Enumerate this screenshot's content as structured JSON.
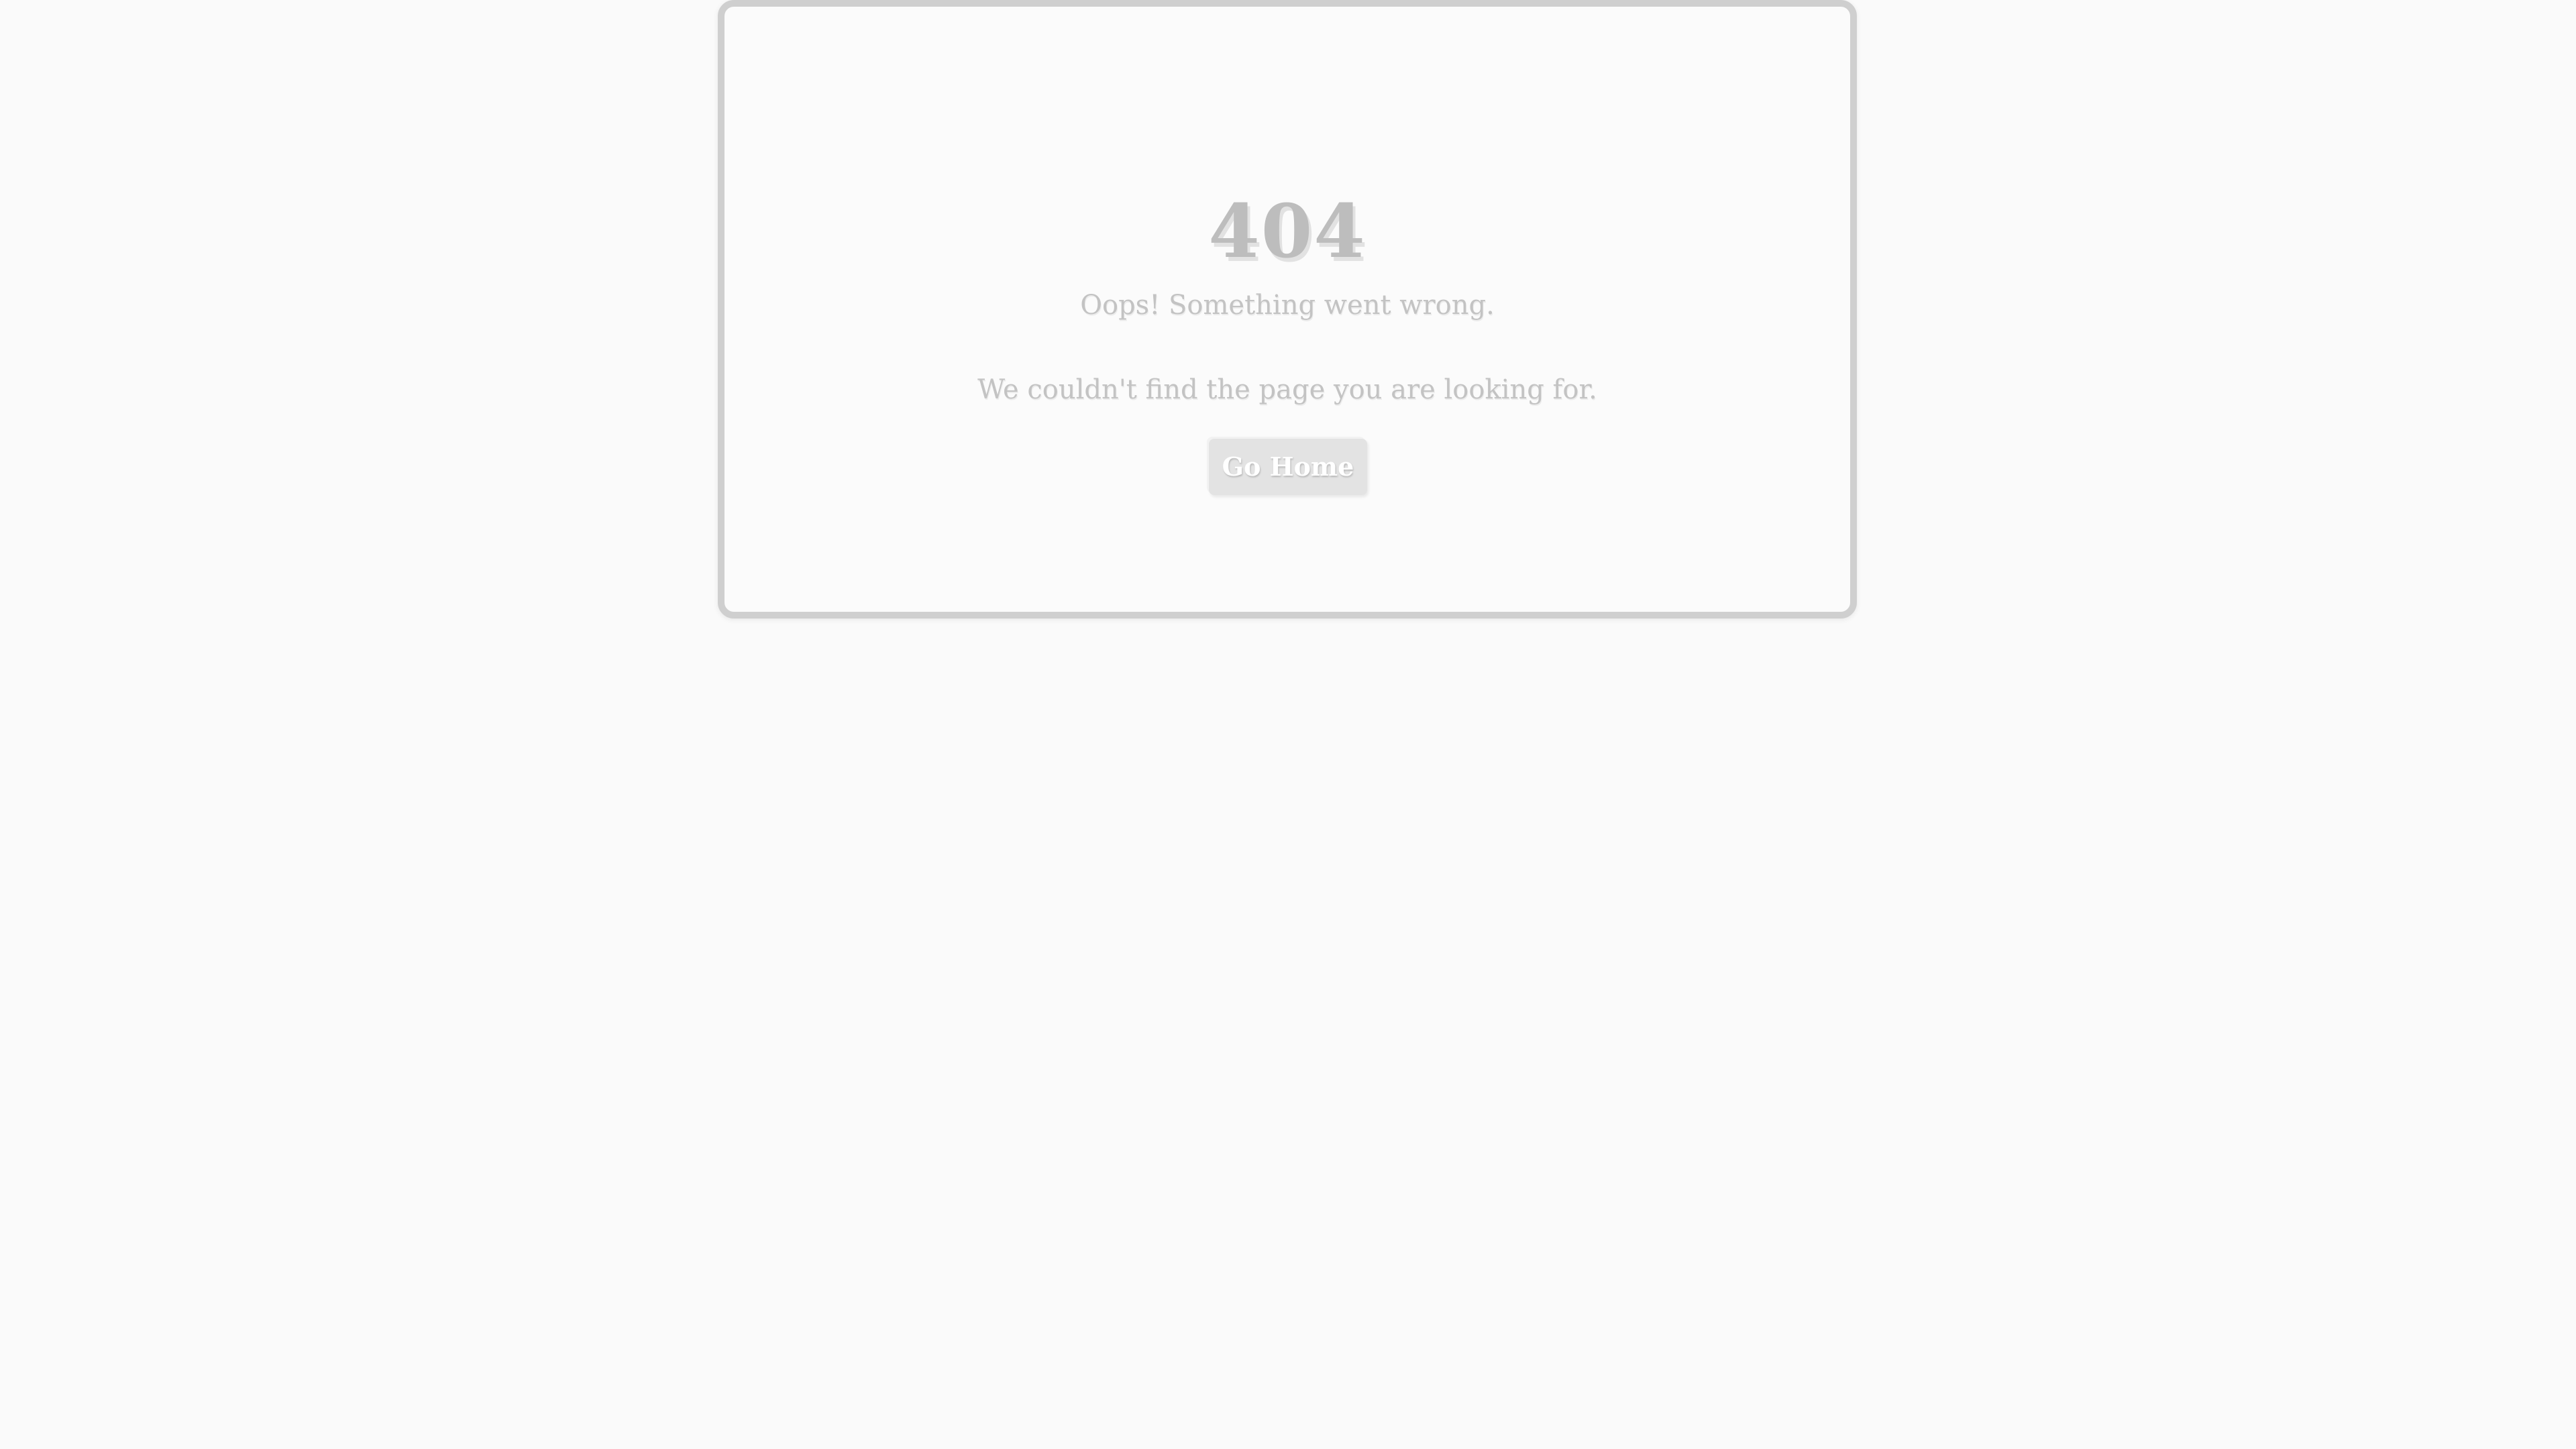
{
  "error": {
    "code": "404",
    "subtitle": "Oops! Something went wrong.",
    "message": "We couldn't find the page you are looking for."
  },
  "actions": {
    "home_label": "Go Home"
  },
  "colors": {
    "background": "#fafafa",
    "card_border": "#cfcfcf",
    "text_muted": "#c3c3c3",
    "button_bg": "#e3e3e3"
  }
}
